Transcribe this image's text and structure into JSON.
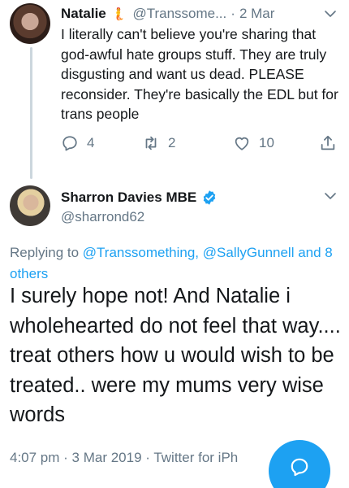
{
  "reply_tweet": {
    "name": "Natalie",
    "name_icon": "mermaid-icon",
    "handle": "@Transsome...",
    "separator": "·",
    "time": "2 Mar",
    "text": "I literally can't believe you're sharing that god-awful hate groups stuff. They are truly disgusting and want us dead. PLEASE reconsider. They're basically the EDL but for trans people",
    "actions": {
      "reply_count": "4",
      "retweet_count": "2",
      "like_count": "10"
    }
  },
  "main_tweet": {
    "name": "Sharron Davies MBE",
    "verified": "verified-badge-icon",
    "handle": "@sharrond62",
    "replying_prefix": "Replying to",
    "replying_mention_1": "@Transsomething,",
    "replying_mention_2": "@SallyGunnell",
    "replying_others": "and 8 others",
    "text": "I surely hope not! And Natalie i wholehearted do not feel that way.... treat others how u would wish to be treated.. were my mums very wise words",
    "meta": "4:07 pm · 3 Mar 2019 · Twitter for iPh"
  },
  "colors": {
    "accent": "#1da1f2",
    "secondary_text": "#657786",
    "primary_text": "#14171a",
    "thread_line": "#ccd6dd"
  },
  "icons": {
    "reply": "reply-icon",
    "retweet": "retweet-icon",
    "like": "heart-icon",
    "share": "share-icon",
    "menu": "chevron-down-icon",
    "compose": "compose-reply-icon"
  }
}
